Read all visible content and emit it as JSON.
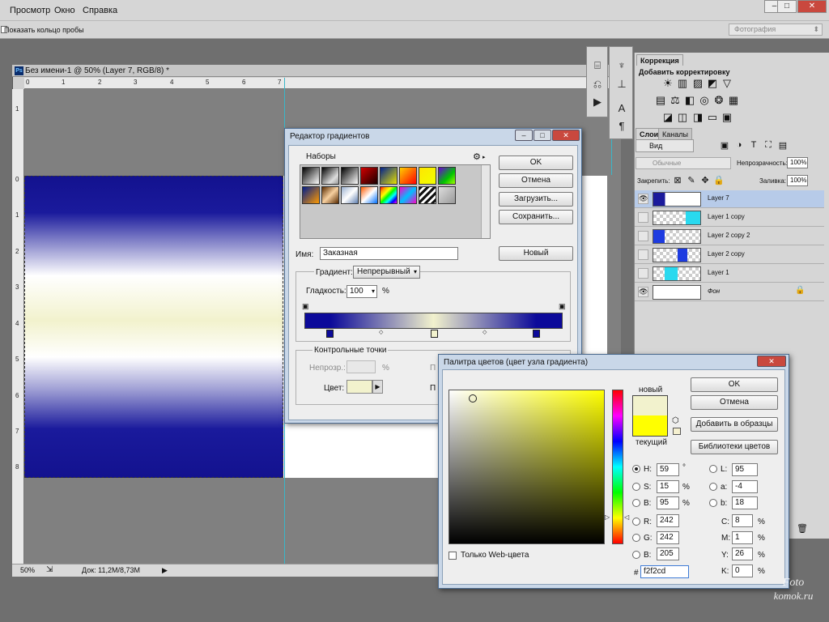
{
  "menubar": {
    "items": [
      "Просмотр",
      "Окно",
      "Справка"
    ]
  },
  "optbar": {
    "checkbox_label": "Показать кольцо пробы",
    "preset_value": "Фотография"
  },
  "document": {
    "title": "Без имени-1 @ 50% (Layer 7, RGB/8) *",
    "ps_logo": "Ps",
    "hruler_ticks": [
      "0",
      "1",
      "2",
      "3",
      "4",
      "5",
      "6",
      "7"
    ],
    "vruler_ticks": [
      "1",
      "0",
      "1",
      "2",
      "3",
      "4",
      "5",
      "6",
      "7",
      "8"
    ],
    "zoom": "50%",
    "doc_info": "Док: 11,2M/8,73M"
  },
  "panels": {
    "correction_tab": "Коррекция",
    "add_adjustment": "Добавить корректировку",
    "layers_tab": "Слои",
    "channels_tab": "Каналы",
    "kind_filter": "Вид",
    "blend_mode": "Обычные",
    "opacity_label": "Непрозрачность:",
    "opacity_value": "100%",
    "lock_label": "Закрепить:",
    "fill_label": "Заливка:",
    "fill_value": "100%",
    "layers": [
      {
        "name": "Layer 7",
        "visible": true,
        "selected": true
      },
      {
        "name": "Layer 1 copy",
        "visible": false,
        "selected": false
      },
      {
        "name": "Layer 2 copy 2",
        "visible": false,
        "selected": false
      },
      {
        "name": "Layer 2 copy",
        "visible": false,
        "selected": false
      },
      {
        "name": "Layer 1",
        "visible": false,
        "selected": false
      },
      {
        "name": "Фон",
        "visible": true,
        "selected": false
      }
    ]
  },
  "gradient_editor": {
    "title": "Редактор градиентов",
    "presets_label": "Наборы",
    "ok": "OK",
    "cancel": "Отмена",
    "load": "Загрузить...",
    "save": "Сохранить...",
    "name_label": "Имя:",
    "name_value": "Заказная",
    "new_button": "Новый",
    "gradient_type_label": "Градиент:",
    "gradient_type_value": "Непрерывный",
    "smoothness_label": "Гладкость:",
    "smoothness_value": "100",
    "percent": "%",
    "stops_group": "Контрольные точки",
    "opacity_label": "Непрозр.:",
    "color_label": "Цвет:",
    "location_prefix_1": "П",
    "location_prefix_2": "П",
    "stop_color": "#f2f2cd",
    "gradient_colors": [
      "#0c0a9a",
      "#f2f2cd",
      "#0c0a9a"
    ]
  },
  "color_picker": {
    "title": "Палитра цветов (цвет узла градиента)",
    "ok": "OK",
    "cancel": "Отмена",
    "add_to_swatches": "Добавить в образцы",
    "color_libraries": "Библиотеки цветов",
    "new_label": "новый",
    "current_label": "текущий",
    "new_color": "#f2f2cd",
    "current_color": "#ffff00",
    "fields": {
      "H": {
        "label": "H:",
        "value": "59",
        "unit": "°",
        "selected": true
      },
      "S": {
        "label": "S:",
        "value": "15",
        "unit": "%"
      },
      "Bv": {
        "label": "B:",
        "value": "95",
        "unit": "%"
      },
      "R": {
        "label": "R:",
        "value": "242"
      },
      "G": {
        "label": "G:",
        "value": "242"
      },
      "B": {
        "label": "B:",
        "value": "205"
      },
      "L": {
        "label": "L:",
        "value": "95"
      },
      "a": {
        "label": "a:",
        "value": "-4"
      },
      "b": {
        "label": "b:",
        "value": "18"
      },
      "C": {
        "label": "C:",
        "value": "8",
        "unit": "%"
      },
      "M": {
        "label": "M:",
        "value": "1",
        "unit": "%"
      },
      "Y": {
        "label": "Y:",
        "value": "26",
        "unit": "%"
      },
      "K": {
        "label": "K:",
        "value": "0",
        "unit": "%"
      }
    },
    "hex_label": "#",
    "hex_value": "f2f2cd",
    "web_only": "Только Web-цвета"
  },
  "watermark": {
    "line1": "Foto",
    "line2": "komok.ru"
  }
}
